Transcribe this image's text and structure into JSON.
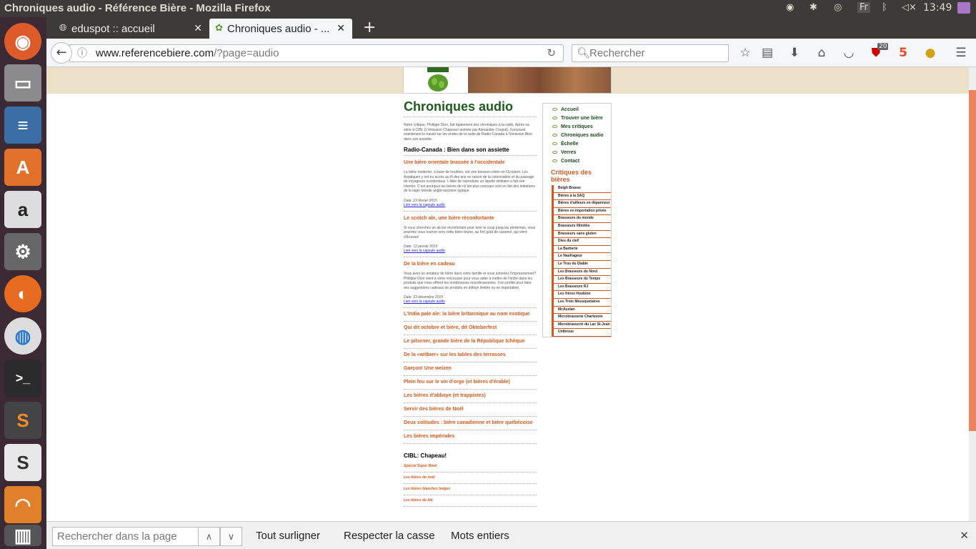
{
  "topbar": {
    "window_title": "Chroniques audio - Référence Bière - Mozilla Firefox",
    "keyboard": "Fr",
    "time": "13:49"
  },
  "launcher": {
    "items": [
      "ubuntu-dash",
      "files",
      "writer",
      "software-center",
      "amazon",
      "system-settings",
      "firefox",
      "chrome",
      "terminal",
      "sublime-text",
      "slack",
      "discord",
      "trash"
    ]
  },
  "tabs": [
    {
      "title": "eduspot :: accueil"
    },
    {
      "title": "Chroniques audio - ..."
    }
  ],
  "navbar": {
    "url_host": "www.referencebiere.com",
    "url_path": "/?page=audio",
    "search_placeholder": "Rechercher",
    "ublock_badge": "20"
  },
  "page": {
    "title": "Chroniques audio",
    "intro": "Notre critique, Philippe Dion, fait également des chroniques à la radio. Après sa série à CIBL (L'émission Chapeau! animée par Alexandre Coupal), il poursuit maintenant le travail sur les ondes de la radio de Radio-Canada à l'émission Bien dans son assiette.",
    "section1": "Radio-Canada : Bien dans son assiette",
    "articles": [
      {
        "title": "Une bière orientale brassée à l'occidentale",
        "body": "La bière moderne, à base de houblon, est une boisson créée en Occident. Les Asiatiques y ont eu accès au fil des ans en raison de la colonisation et du passage de voyageurs occidentaux. L'idée de reproduire un liquide similaire a fait son chemin. C'est pourquoi les bières de riz les plus connues sont en fait des imitations de la lager blonde anglo-saxonne typique.",
        "date": "Date: 23 février 2015",
        "link": "Lien vers la capsule audio"
      },
      {
        "title": "Le scotch ale, une bière réconfortante",
        "body": "Si vous cherchez un alcool réconfortant pour tenir le coup jusqu'au printemps, vous pourriez vous tourner vers cette bière brune, au fort goût de caramel, qui vient d'Écosse!",
        "date": "Date: 12 janvier 2015",
        "link": "Lien vers la capsule audio"
      },
      {
        "title": "De la bière en cadeau",
        "body": "Vous avez un amateur de bière dans votre famille et vous aimeriez l'impressionner? Philippe Dion vient à votre rescousse pour vous aider à mettre de l'ordre dans les produits que nous offrent les nombreuses microbrasseries. Il en profite pour faire ses suggestions cadeaux de produits en édition limitée ou en importation.",
        "date": "Date: 23 décembre 2015",
        "link": "Lien vers la capsule audio"
      }
    ],
    "more_titles": [
      "L'India pale ale: la bière britannique au nom exotique",
      "Qui dit octobre et bière, dit Oktoberfest",
      "Le pilsener, grande bière de la République tchèque",
      "De la «witbier» sur les tables des terrasses",
      "Garçon! Une weizen",
      "Plein feu sur le vin d'orge (et bières d'érable)",
      "Les bières d'abbaye (et trappistes)",
      "Servir des bières de Noël",
      "Deux solitudes : bière canadienne et bière québécoise",
      "Les bières impériales"
    ],
    "section2": "CIBL: Chapeau!",
    "cibl_items": [
      "Spécial Super Bowl",
      "Les bières de noël",
      "Les bières blanches belges",
      "Les bières de blé"
    ]
  },
  "sidebar": {
    "nav": [
      "Accueil",
      "Trouver une bière",
      "Mes critiques",
      "Chroniques audio",
      "Échelle",
      "Verres",
      "Contact"
    ],
    "heading": "Critiques des bières",
    "links": [
      "Belgh Brasse",
      "Bières à la SAQ",
      "Bières d'ailleurs en dépanneur",
      "Bières en importation privée",
      "Brasseurs du monde",
      "Brasseurs illimités",
      "Brasseurs sans gluten",
      "Dieu du ciel!",
      "La Barberie",
      "Le Naufrageur",
      "Le Trou du Diable",
      "Les Brasseurs du Nord",
      "Les Brasseurs du Temps",
      "Les Brasseurs RJ",
      "Les frères Houblon",
      "Les Trois Mousquetaires",
      "McAuslan",
      "Microbrasserie Charlevoix",
      "Microbrasserie du Lac St-Jean",
      "Unibroue"
    ]
  },
  "findbar": {
    "placeholder": "Rechercher dans la page",
    "highlight_all": "Tout surligner",
    "match_case": "Respecter la casse",
    "whole_words": "Mots entiers"
  }
}
